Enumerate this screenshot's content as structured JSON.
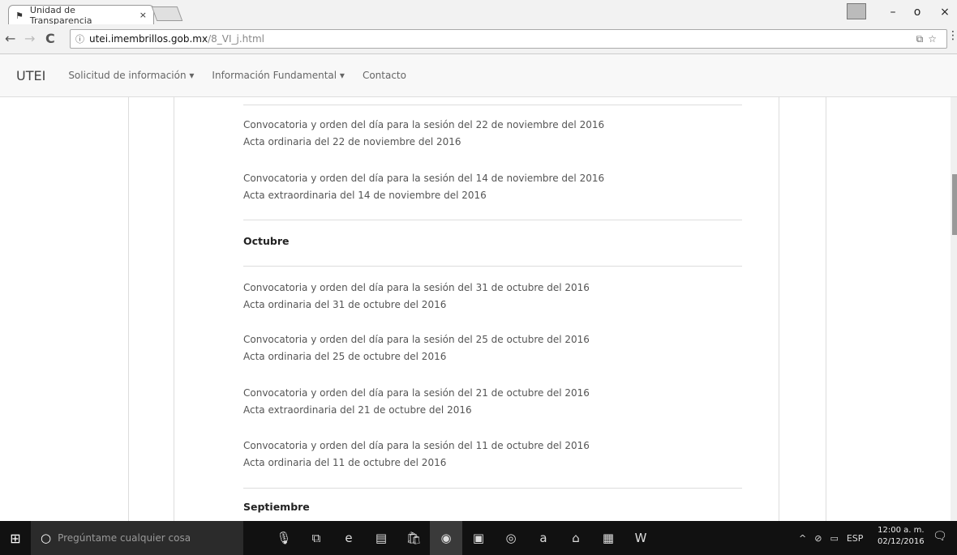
{
  "browser": {
    "tab_title": "Unidad de Transparencia",
    "tab_close": "×",
    "url_host": "utei.imembrillos.gob.mx",
    "url_path": "/8_VI_j.html",
    "info_icon": "ⓘ",
    "back": "←",
    "forward": "→",
    "reload": "C",
    "win_min": "–",
    "win_restore": "o",
    "win_close": "×",
    "omnibox_right": "⧉☆",
    "menu": "⋮"
  },
  "site": {
    "brand": "UTEI",
    "nav": [
      "Solicitud de información ▾",
      "Información Fundamental ▾",
      "Contacto"
    ]
  },
  "content": {
    "entries": [
      {
        "convocatoria": "Convocatoria y orden del día para la sesión del 22 de noviembre del 2016",
        "acta": "Acta ordinaria del 22 de noviembre del 2016"
      },
      {
        "convocatoria": "Convocatoria y orden del día para la sesión del 14 de noviembre del 2016",
        "acta": "Acta extraordinaria del 14 de noviembre del 2016"
      },
      {
        "convocatoria": "Convocatoria y orden del día para la sesión del 31 de octubre del 2016",
        "acta": "Acta ordinaria del 31 de octubre del 2016"
      },
      {
        "convocatoria": "Convocatoria y orden del día para la sesión del 25 de octubre del 2016",
        "acta": "Acta ordinaria del 25 de octubre del 2016"
      },
      {
        "convocatoria": "Convocatoria y orden del día para la sesión del 21 de octubre del 2016",
        "acta": "Acta extraordinaria del 21 de octubre del 2016"
      },
      {
        "convocatoria": "Convocatoria y orden del día para la sesión del 11 de octubre del 2016",
        "acta": "Acta ordinaria del 11 de octubre del 2016"
      }
    ],
    "month_octubre": "Octubre",
    "month_septiembre": "Septiembre"
  },
  "taskbar": {
    "start": "⊞",
    "search_placeholder": "Pregúntame cualquier cosa",
    "cortana": "○",
    "icons": [
      "🎙",
      "⧉",
      "e",
      "▤",
      "🛍",
      "◉",
      "▣",
      "◎",
      "a",
      "⌂",
      "▦",
      "W"
    ],
    "tray_up": "^",
    "tray_net": "⊘",
    "tray_batt": "▭",
    "lang": "ESP",
    "time": "12:00 a. m.",
    "date": "02/12/2016",
    "notifications": "🗨"
  }
}
